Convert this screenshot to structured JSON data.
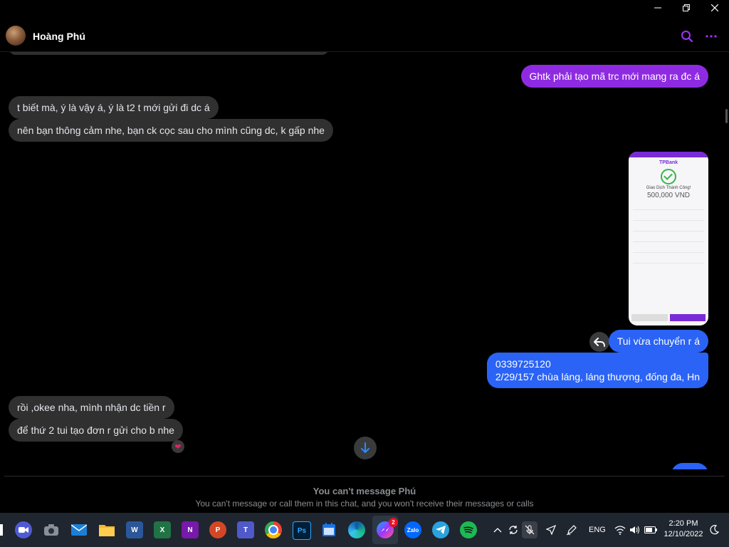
{
  "window": {
    "controls": [
      "minimize",
      "restore",
      "close"
    ]
  },
  "header": {
    "contact_name": "Hoàng Phú",
    "icons": [
      "search-icon",
      "more-icon"
    ],
    "accent": "#a033ff"
  },
  "messages": {
    "m1": "Ghtk phải tạo mã trc mới mang ra đc á",
    "m2": "t biết mà, ý là vậy á, ý là t2 t mới gửi đi dc á",
    "m3": "nên bạn thông cảm nhe, bạn ck cọc sau cho mình cũng dc, k gấp nhe",
    "m4": "Tui vừa chuyển r á",
    "m5_line1": "0339725120",
    "m5_line2": "2/29/157 chùa láng, láng thượng, đống đa, Hn",
    "m6": "rồi ,okee nha, mình nhận dc tiền r",
    "m7": "để thứ 2 tui tạo đơn r gửi cho b nhe"
  },
  "shared_image": {
    "brand": "TPBank",
    "status": "Giao Dịch Thành Công!",
    "amount": "500,000 VND"
  },
  "reaction": "❤",
  "notice": {
    "title": "You can't message Phú",
    "subtitle": "You can't message or call them in this chat, and you won't receive their messages or calls"
  },
  "taskbar": {
    "apps": [
      "zoom",
      "camera",
      "mail",
      "file-explorer",
      "word",
      "excel",
      "onenote",
      "powerpoint",
      "teams",
      "chrome",
      "photoshop",
      "calendar",
      "edge",
      "messenger",
      "zalo",
      "telegram",
      "spotify"
    ],
    "app_labels": {
      "word": "W",
      "excel": "X",
      "onenote": "N",
      "powerpoint": "P",
      "teams": "T",
      "photoshop": "Ps",
      "zalo": "Zalo"
    },
    "messenger_badge": "2",
    "language": "ENG",
    "time": "2:20 PM",
    "date": "12/10/2022"
  },
  "colors": {
    "outgoing_purple": "#8e2be2",
    "outgoing_blue": "#2a63f5",
    "incoming": "#303030",
    "background": "#000000"
  }
}
